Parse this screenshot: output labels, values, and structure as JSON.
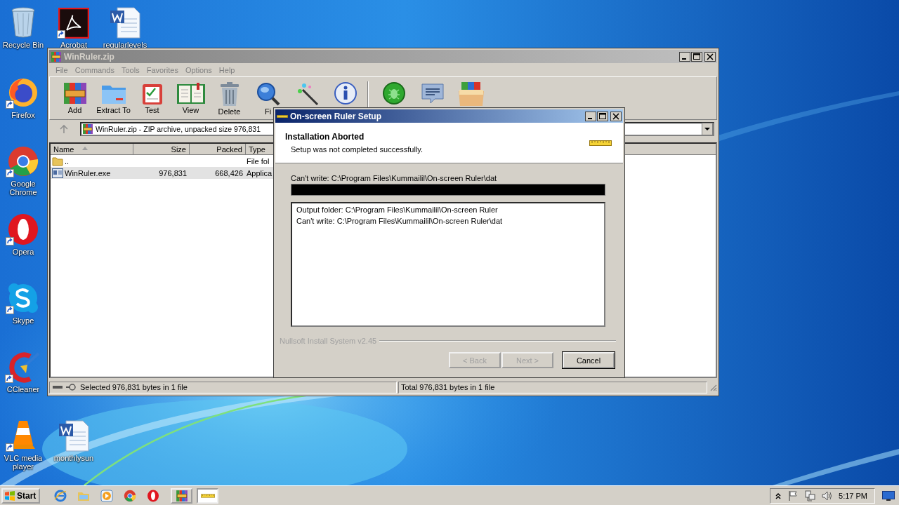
{
  "desktop_icons": [
    {
      "label": "Recycle Bin",
      "kind": "recycle",
      "shortcut": false
    },
    {
      "label": "Acrobat",
      "kind": "acrobat",
      "shortcut": true
    },
    {
      "label": "regularlevels",
      "kind": "word",
      "shortcut": false
    },
    {
      "label": "Firefox",
      "kind": "firefox",
      "shortcut": true
    },
    {
      "label": "Google Chrome",
      "kind": "chrome",
      "shortcut": true
    },
    {
      "label": "Opera",
      "kind": "opera",
      "shortcut": true
    },
    {
      "label": "Skype",
      "kind": "skype",
      "shortcut": true
    },
    {
      "label": "CCleaner",
      "kind": "ccleaner",
      "shortcut": true
    },
    {
      "label": "VLC media player",
      "kind": "vlc",
      "shortcut": true
    },
    {
      "label": "monthlysun",
      "kind": "word",
      "shortcut": false
    }
  ],
  "archiver": {
    "title": "WinRuler.zip",
    "menu": [
      "File",
      "Commands",
      "Tools",
      "Favorites",
      "Options",
      "Help"
    ],
    "toolbar": [
      {
        "label": "Add",
        "kind": "add"
      },
      {
        "label": "Extract To",
        "kind": "extract"
      },
      {
        "label": "Test",
        "kind": "test"
      },
      {
        "label": "View",
        "kind": "view"
      },
      {
        "label": "Delete",
        "kind": "delete"
      },
      {
        "label": "Fi",
        "kind": "find"
      },
      {
        "kind": "wizard"
      },
      {
        "kind": "info"
      },
      {
        "kind": "virus"
      },
      {
        "kind": "comment"
      },
      {
        "kind": "sfx"
      }
    ],
    "address": "WinRuler.zip - ZIP archive, unpacked size 976,831",
    "columns": [
      "Name",
      "Size",
      "Packed",
      "Type"
    ],
    "rows": [
      {
        "kind": "folder",
        "name": "..",
        "size": "",
        "packed": "",
        "type": "File fol",
        "selected": false
      },
      {
        "kind": "file",
        "name": "WinRuler.exe",
        "size": "976,831",
        "packed": "668,426",
        "type": "Applica",
        "selected": true
      }
    ],
    "status_left": "Selected 976,831 bytes in 1 file",
    "status_right": "Total 976,831 bytes in 1 file"
  },
  "setup": {
    "title": "On-screen Ruler Setup",
    "heading": "Installation Aborted",
    "subheading": "Setup was not completed successfully.",
    "status": "Can't write: C:\\Program Files\\Kummailil\\On-screen Ruler\\dat",
    "progress": {
      "level": 1
    },
    "log": [
      "Output folder: C:\\Program Files\\Kummailil\\On-screen Ruler",
      "Can't write: C:\\Program Files\\Kummailil\\On-screen Ruler\\dat"
    ],
    "branding": "Nullsoft Install System v2.45",
    "buttons": [
      {
        "label": "< Back",
        "disabled": true
      },
      {
        "label": "Next >",
        "disabled": true
      },
      {
        "label": "Cancel",
        "disabled": false
      }
    ]
  },
  "taskbar": {
    "start": "Start",
    "quick_launch": [
      {
        "kind": "ie"
      },
      {
        "kind": "explorer"
      },
      {
        "kind": "media"
      },
      {
        "kind": "chrome"
      },
      {
        "kind": "opera"
      }
    ],
    "tasks": [
      {
        "kind": "winrar",
        "selected": false
      },
      {
        "kind": "ruler",
        "selected": true
      }
    ],
    "tray": [
      {
        "kind": "chevron"
      },
      {
        "kind": "flag"
      },
      {
        "kind": "network"
      },
      {
        "kind": "volume"
      }
    ],
    "clock": "5:17 PM"
  }
}
